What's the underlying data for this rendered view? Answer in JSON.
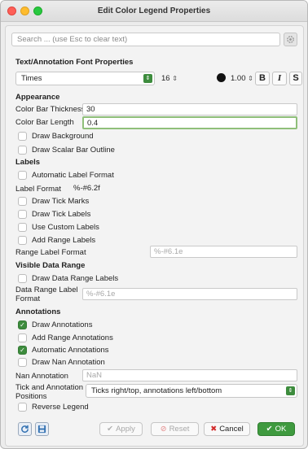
{
  "window": {
    "title": "Edit Color Legend Properties"
  },
  "search": {
    "placeholder": "Search ... (use Esc to clear text)"
  },
  "font_section": {
    "header": "Text/Annotation Font Properties",
    "family": "Times",
    "size": "16",
    "opacity": "1.00",
    "bold_label": "B",
    "italic_label": "I",
    "shadow_label": "S"
  },
  "appearance": {
    "header": "Appearance",
    "thickness_label": "Color Bar Thickness",
    "thickness_value": "30",
    "length_label": "Color Bar Length",
    "length_value": "0.4",
    "draw_background": "Draw Background",
    "draw_outline": "Draw Scalar Bar Outline"
  },
  "labels": {
    "header": "Labels",
    "auto_format": "Automatic Label Format",
    "format_label": "Label Format",
    "format_value": "%-#6.2f",
    "draw_tick_marks": "Draw Tick Marks",
    "draw_tick_labels": "Draw Tick Labels",
    "custom_labels": "Use Custom Labels",
    "add_range_labels": "Add Range Labels",
    "range_format_label": "Range Label Format",
    "range_format_placeholder": "%-#6.1e"
  },
  "visible_range": {
    "header": "Visible Data Range",
    "draw_range_labels": "Draw Data Range Labels",
    "range_label_format_line1": "Data Range Label",
    "range_label_format_line2": "Format",
    "range_label_placeholder": "%-#6.1e"
  },
  "annotations": {
    "header": "Annotations",
    "draw_annotations": "Draw Annotations",
    "add_range_annotations": "Add Range Annotations",
    "automatic_annotations": "Automatic Annotations",
    "draw_nan": "Draw Nan Annotation",
    "nan_label": "Nan Annotation",
    "nan_placeholder": "NaN",
    "positions_label_line1": "Tick and Annotation",
    "positions_label_line2": "Positions",
    "positions_value": "Ticks right/top, annotations left/bottom",
    "reverse_legend": "Reverse Legend"
  },
  "buttons": {
    "apply": "Apply",
    "reset": "Reset",
    "cancel": "Cancel",
    "ok": "OK"
  },
  "colors": {
    "accent_green": "#3f9a3f",
    "checkbox_on": "#3d8c3d",
    "focus_border": "#8fbf7a",
    "cancel_x": "#d22b2b"
  }
}
